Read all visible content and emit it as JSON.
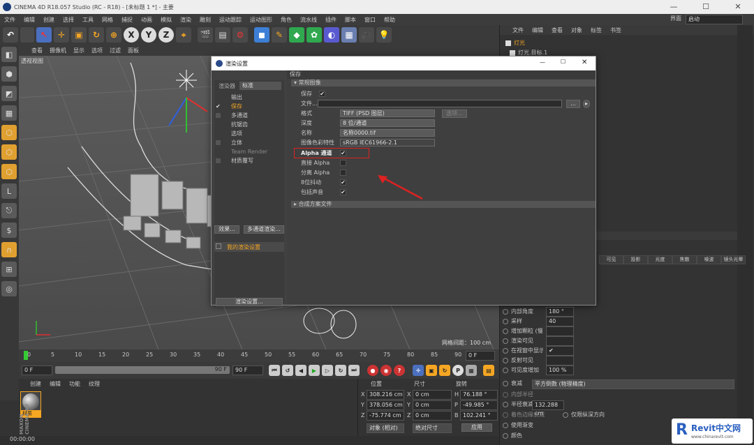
{
  "window": {
    "title": "CINEMA 4D R18.057 Studio (RC - R18) - [未标题 1 *] - 主要",
    "min": "—",
    "max": "☐",
    "close": "✕"
  },
  "menu": [
    "文件",
    "编辑",
    "创建",
    "选择",
    "工具",
    "网格",
    "捕捉",
    "动画",
    "模拟",
    "渲染",
    "雕刻",
    "运动跟踪",
    "运动图形",
    "角色",
    "流水线",
    "插件",
    "脚本",
    "窗口",
    "帮助"
  ],
  "layout": {
    "label": "界面",
    "value": "启动"
  },
  "toolbar": {
    "x": "X",
    "y": "Y",
    "z": "Z"
  },
  "viewport": {
    "menu": [
      "查看",
      "摄像机",
      "显示",
      "选项",
      "过滤",
      "面板"
    ],
    "label": "透视视图",
    "scale": "网格间距：100 cm"
  },
  "timeline": {
    "ticks": [
      "0",
      "5",
      "10",
      "15",
      "20",
      "25",
      "30",
      "35",
      "40",
      "45",
      "50",
      "55",
      "60",
      "65",
      "70",
      "75",
      "80",
      "85",
      "90"
    ],
    "end": "0 F"
  },
  "transport": {
    "start": "0 F",
    "end": "90 F",
    "range": "90 F"
  },
  "materials": {
    "menu": [
      "创建",
      "编辑",
      "功能",
      "纹理"
    ],
    "item": "材质"
  },
  "coords": {
    "headers": [
      "位置",
      "尺寸",
      "旋转"
    ],
    "rows": [
      {
        "a": "X",
        "pos": "308.216 cm",
        "s": "X",
        "size": "0 cm",
        "r": "H",
        "rot": "76.188 °"
      },
      {
        "a": "Y",
        "pos": "378.056 cm",
        "s": "Y",
        "size": "0 cm",
        "r": "P",
        "rot": "-49.985 °"
      },
      {
        "a": "Z",
        "pos": "-75.774 cm",
        "s": "Z",
        "size": "0 cm",
        "r": "B",
        "rot": "102.241 °"
      }
    ],
    "mode": "对象 (相对)",
    "sizemode": "绝对尺寸",
    "apply": "应用"
  },
  "status": "00:00:00",
  "objects": {
    "menu": [
      "文件",
      "编辑",
      "查看",
      "对象",
      "标签",
      "书签"
    ],
    "items": [
      "灯光",
      "灯光.目标.1"
    ]
  },
  "attr": {
    "tabs": [
      "可见",
      "投影",
      "光度",
      "焦散",
      "噪波",
      "镜头光晕"
    ],
    "rows": [
      {
        "label": "内部角度",
        "value": "180 °"
      },
      {
        "label": "采样",
        "value": "40"
      },
      {
        "label": "增加颗粒 (慢)",
        "value": ""
      },
      {
        "label": "渲染可见",
        "value": ""
      },
      {
        "label": "在视窗中显示",
        "value": "✔"
      },
      {
        "label": "反射可见",
        "value": ""
      },
      {
        "label": "可见度增加",
        "value": "100 %"
      }
    ],
    "decay": {
      "label": "衰减",
      "value": "平方倒数 (物理精度)"
    },
    "inner": "内部半径",
    "radius": {
      "label": "半径衰减",
      "value": "132.288 cm"
    },
    "color_decay": "着色边缘衰减",
    "distance": "仅限纵深方向",
    "gradient": "使用渐变",
    "color": "颜色"
  },
  "dialog": {
    "title": "渲染设置",
    "renderer_label": "渲染器",
    "renderer": "标准",
    "nav": [
      "输出",
      "保存",
      "多通道",
      "抗锯齿",
      "选项",
      "立体",
      "Team Render",
      "材质覆写"
    ],
    "effect_btn": "效果...",
    "multipass_btn": "多通道渲染...",
    "preset": "我的渲染设置",
    "settings_btn": "渲染设置...",
    "section": "保存",
    "sub1": "常规图像",
    "sub2": "合成方案文件",
    "save": "保存",
    "file": "文件...",
    "format": {
      "label": "格式",
      "value": "TIFF (PSD 图层)"
    },
    "options": "选项...",
    "depth": {
      "label": "深度",
      "value": "8 位/通道"
    },
    "name": {
      "label": "名称",
      "value": "名称0000.tif"
    },
    "profile": {
      "label": "图像色彩特性",
      "value": "sRGB IEC61966-2.1"
    },
    "alpha": "Alpha 通道",
    "straight": "直接 Alpha",
    "separate": "分离 Alpha",
    "dither": "8位抖动",
    "sound": "包括声音"
  },
  "watermark": {
    "brand": "Revit中文网",
    "url": "www.chinarevit.com"
  },
  "colors": {
    "accent": "#f5a623",
    "highlight": "#d22",
    "bg": "#333"
  }
}
